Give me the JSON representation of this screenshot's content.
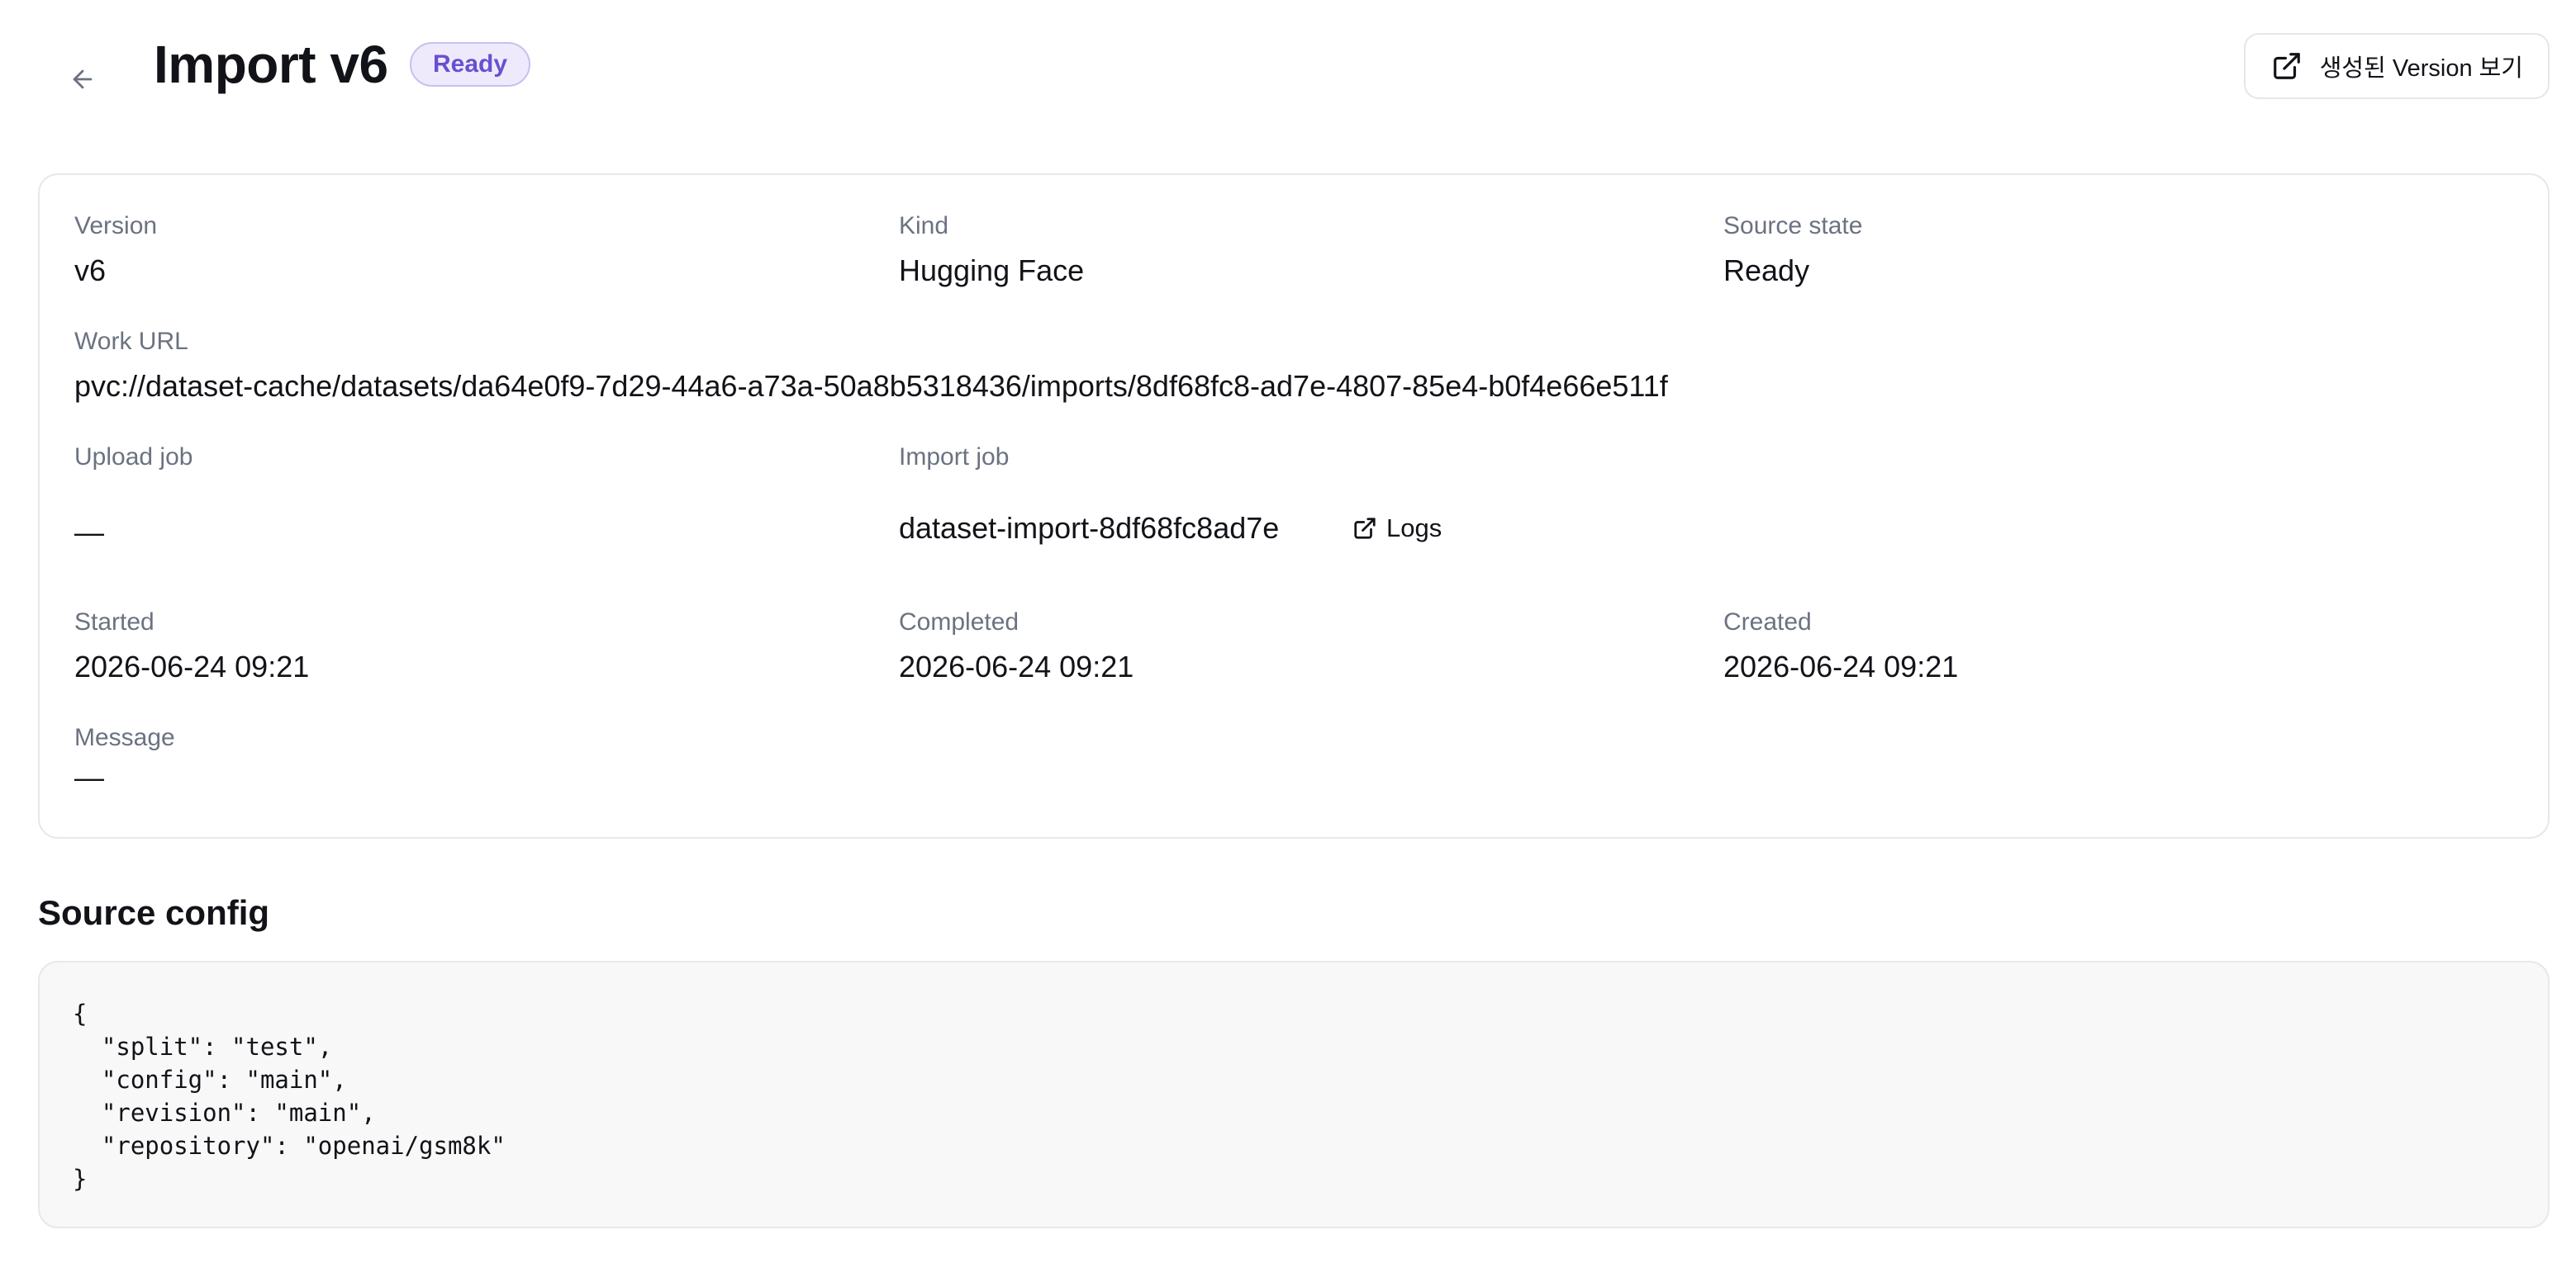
{
  "header": {
    "title": "Import v6",
    "status_badge": "Ready",
    "view_version_label": "생성된 Version 보기"
  },
  "details": {
    "version": {
      "label": "Version",
      "value": "v6"
    },
    "kind": {
      "label": "Kind",
      "value": "Hugging Face"
    },
    "source_state": {
      "label": "Source state",
      "value": "Ready"
    },
    "work_url": {
      "label": "Work URL",
      "value": "pvc://dataset-cache/datasets/da64e0f9-7d29-44a6-a73a-50a8b5318436/imports/8df68fc8-ad7e-4807-85e4-b0f4e66e511f"
    },
    "upload_job": {
      "label": "Upload job",
      "value": "—"
    },
    "import_job": {
      "label": "Import job",
      "value": "dataset-import-8df68fc8ad7e",
      "logs_label": "Logs"
    },
    "started": {
      "label": "Started",
      "value": "2026-06-24 09:21"
    },
    "completed": {
      "label": "Completed",
      "value": "2026-06-24 09:21"
    },
    "created": {
      "label": "Created",
      "value": "2026-06-24 09:21"
    },
    "message": {
      "label": "Message",
      "value": "—"
    }
  },
  "source_config": {
    "title": "Source config",
    "code": "{\n  \"split\": \"test\",\n  \"config\": \"main\",\n  \"revision\": \"main\",\n  \"repository\": \"openai/gsm8k\"\n}"
  },
  "icons": {
    "back": "arrow-left-icon",
    "external_link": "external-link-icon"
  },
  "colors": {
    "badge_text": "#6a4fcf",
    "badge_bg": "#eeeafc",
    "badge_border": "#c9bff0",
    "label_text": "#6b7280",
    "card_border": "#e6e8ec",
    "code_bg": "#f8f8f8"
  }
}
